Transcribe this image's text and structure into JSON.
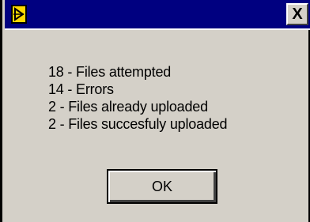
{
  "titlebar": {
    "icon": "labview-run-arrow-icon",
    "close_label": "X"
  },
  "messages": [
    "18 - Files attempted",
    "14 - Errors",
    "2 - Files already uploaded",
    "2 - Files succesfuly uploaded"
  ],
  "buttons": {
    "ok_label": "OK"
  },
  "colors": {
    "titlebar": "#000080",
    "dialog_face": "#d4d0c8",
    "icon_fill": "#ffd800"
  }
}
